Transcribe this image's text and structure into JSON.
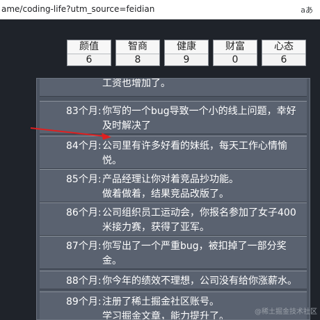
{
  "browser": {
    "url": "ame/coding-life?utm_source=feidian",
    "text_size_icon": "aあ"
  },
  "stats": [
    {
      "label": "颜值",
      "value": "6"
    },
    {
      "label": "智商",
      "value": "8"
    },
    {
      "label": "健康",
      "value": "9"
    },
    {
      "label": "财富",
      "value": "0"
    },
    {
      "label": "心态",
      "value": "6"
    }
  ],
  "events": [
    {
      "age": "",
      "lines": [
        "工资也增加了。"
      ]
    },
    {
      "age": "83个月:",
      "lines": [
        "你写的一个bug导致一个小的线上问题，幸好",
        "及时解决了"
      ]
    },
    {
      "age": "84个月:",
      "lines": [
        "公司里有许多好看的妹纸，每天工作心情愉",
        "悦。"
      ]
    },
    {
      "age": "85个月:",
      "lines": [
        "产品经理让你对着竞品抄功能。",
        "做着做着，结果竞品改版了。"
      ]
    },
    {
      "age": "86个月:",
      "lines": [
        "公司组织员工运动会，你报名参加了女子400",
        "米接力赛，获得了亚军。"
      ]
    },
    {
      "age": "87个月:",
      "lines": [
        "你写出了一个严重bug，被扣掉了一部分奖",
        "金。"
      ]
    },
    {
      "age": "88个月:",
      "lines": [
        "你今年的绩效不理想，公司没有给你涨薪水。"
      ]
    },
    {
      "age": "89个月:",
      "lines": [
        "注册了稀土掘金社区账号。",
        "学习掘金文章，能力提升了。"
      ]
    }
  ],
  "watermark": "@稀土掘金技术社区",
  "colors": {
    "arrow": "#e02020",
    "background": "#1f232a"
  }
}
